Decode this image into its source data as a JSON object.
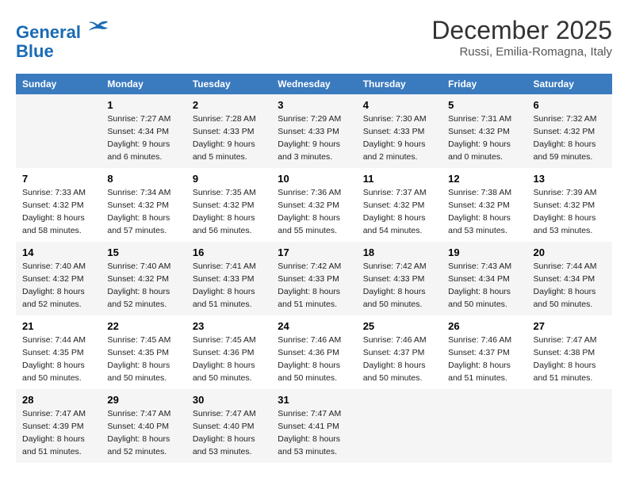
{
  "header": {
    "logo_line1": "General",
    "logo_line2": "Blue",
    "month_title": "December 2025",
    "location": "Russi, Emilia-Romagna, Italy"
  },
  "days_of_week": [
    "Sunday",
    "Monday",
    "Tuesday",
    "Wednesday",
    "Thursday",
    "Friday",
    "Saturday"
  ],
  "weeks": [
    [
      {
        "day": "",
        "info": ""
      },
      {
        "day": "1",
        "info": "Sunrise: 7:27 AM\nSunset: 4:34 PM\nDaylight: 9 hours\nand 6 minutes."
      },
      {
        "day": "2",
        "info": "Sunrise: 7:28 AM\nSunset: 4:33 PM\nDaylight: 9 hours\nand 5 minutes."
      },
      {
        "day": "3",
        "info": "Sunrise: 7:29 AM\nSunset: 4:33 PM\nDaylight: 9 hours\nand 3 minutes."
      },
      {
        "day": "4",
        "info": "Sunrise: 7:30 AM\nSunset: 4:33 PM\nDaylight: 9 hours\nand 2 minutes."
      },
      {
        "day": "5",
        "info": "Sunrise: 7:31 AM\nSunset: 4:32 PM\nDaylight: 9 hours\nand 0 minutes."
      },
      {
        "day": "6",
        "info": "Sunrise: 7:32 AM\nSunset: 4:32 PM\nDaylight: 8 hours\nand 59 minutes."
      }
    ],
    [
      {
        "day": "7",
        "info": "Sunrise: 7:33 AM\nSunset: 4:32 PM\nDaylight: 8 hours\nand 58 minutes."
      },
      {
        "day": "8",
        "info": "Sunrise: 7:34 AM\nSunset: 4:32 PM\nDaylight: 8 hours\nand 57 minutes."
      },
      {
        "day": "9",
        "info": "Sunrise: 7:35 AM\nSunset: 4:32 PM\nDaylight: 8 hours\nand 56 minutes."
      },
      {
        "day": "10",
        "info": "Sunrise: 7:36 AM\nSunset: 4:32 PM\nDaylight: 8 hours\nand 55 minutes."
      },
      {
        "day": "11",
        "info": "Sunrise: 7:37 AM\nSunset: 4:32 PM\nDaylight: 8 hours\nand 54 minutes."
      },
      {
        "day": "12",
        "info": "Sunrise: 7:38 AM\nSunset: 4:32 PM\nDaylight: 8 hours\nand 53 minutes."
      },
      {
        "day": "13",
        "info": "Sunrise: 7:39 AM\nSunset: 4:32 PM\nDaylight: 8 hours\nand 53 minutes."
      }
    ],
    [
      {
        "day": "14",
        "info": "Sunrise: 7:40 AM\nSunset: 4:32 PM\nDaylight: 8 hours\nand 52 minutes."
      },
      {
        "day": "15",
        "info": "Sunrise: 7:40 AM\nSunset: 4:32 PM\nDaylight: 8 hours\nand 52 minutes."
      },
      {
        "day": "16",
        "info": "Sunrise: 7:41 AM\nSunset: 4:33 PM\nDaylight: 8 hours\nand 51 minutes."
      },
      {
        "day": "17",
        "info": "Sunrise: 7:42 AM\nSunset: 4:33 PM\nDaylight: 8 hours\nand 51 minutes."
      },
      {
        "day": "18",
        "info": "Sunrise: 7:42 AM\nSunset: 4:33 PM\nDaylight: 8 hours\nand 50 minutes."
      },
      {
        "day": "19",
        "info": "Sunrise: 7:43 AM\nSunset: 4:34 PM\nDaylight: 8 hours\nand 50 minutes."
      },
      {
        "day": "20",
        "info": "Sunrise: 7:44 AM\nSunset: 4:34 PM\nDaylight: 8 hours\nand 50 minutes."
      }
    ],
    [
      {
        "day": "21",
        "info": "Sunrise: 7:44 AM\nSunset: 4:35 PM\nDaylight: 8 hours\nand 50 minutes."
      },
      {
        "day": "22",
        "info": "Sunrise: 7:45 AM\nSunset: 4:35 PM\nDaylight: 8 hours\nand 50 minutes."
      },
      {
        "day": "23",
        "info": "Sunrise: 7:45 AM\nSunset: 4:36 PM\nDaylight: 8 hours\nand 50 minutes."
      },
      {
        "day": "24",
        "info": "Sunrise: 7:46 AM\nSunset: 4:36 PM\nDaylight: 8 hours\nand 50 minutes."
      },
      {
        "day": "25",
        "info": "Sunrise: 7:46 AM\nSunset: 4:37 PM\nDaylight: 8 hours\nand 50 minutes."
      },
      {
        "day": "26",
        "info": "Sunrise: 7:46 AM\nSunset: 4:37 PM\nDaylight: 8 hours\nand 51 minutes."
      },
      {
        "day": "27",
        "info": "Sunrise: 7:47 AM\nSunset: 4:38 PM\nDaylight: 8 hours\nand 51 minutes."
      }
    ],
    [
      {
        "day": "28",
        "info": "Sunrise: 7:47 AM\nSunset: 4:39 PM\nDaylight: 8 hours\nand 51 minutes."
      },
      {
        "day": "29",
        "info": "Sunrise: 7:47 AM\nSunset: 4:40 PM\nDaylight: 8 hours\nand 52 minutes."
      },
      {
        "day": "30",
        "info": "Sunrise: 7:47 AM\nSunset: 4:40 PM\nDaylight: 8 hours\nand 53 minutes."
      },
      {
        "day": "31",
        "info": "Sunrise: 7:47 AM\nSunset: 4:41 PM\nDaylight: 8 hours\nand 53 minutes."
      },
      {
        "day": "",
        "info": ""
      },
      {
        "day": "",
        "info": ""
      },
      {
        "day": "",
        "info": ""
      }
    ]
  ]
}
